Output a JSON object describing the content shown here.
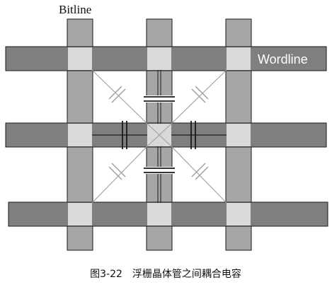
{
  "labels": {
    "bitline": "Bitline",
    "wordline": "Wordline"
  },
  "caption": "图3-22　浮栅晶体管之间耦合电容",
  "colors": {
    "wordline_fill": "#7f7f7f",
    "bitline_fill": "#a6a6a6",
    "cell_fill": "#d9d9d9",
    "outline": "#1a1a1a",
    "coupling_line": "#a0a0a0",
    "capacitor_plate": "#1a1a1a"
  }
}
